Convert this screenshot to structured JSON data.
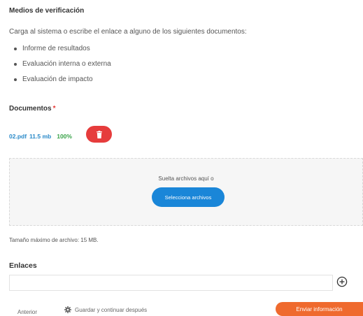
{
  "verification": {
    "title": "Medios de verificación",
    "intro": "Carga al sistema o escribe el enlace a alguno de los siguientes documentos:",
    "items": [
      {
        "label": "Informe de resultados"
      },
      {
        "label": "Evaluación interna o externa"
      },
      {
        "label": "Evaluación de impacto"
      }
    ]
  },
  "documents": {
    "label": "Documentos",
    "required_mark": "*",
    "file": {
      "name": "02.pdf",
      "size": "11.5 mb",
      "progress": "100%"
    },
    "delete_icon": "trash-icon"
  },
  "dropzone": {
    "text": "Suelta archivos aquí o",
    "button_label": "Selecciona archivos"
  },
  "max_size_text": "Tamaño máximo de archivo: 15 MB.",
  "links": {
    "title": "Enlaces",
    "input_value": "",
    "add_icon": "plus-circle-icon"
  },
  "footer": {
    "prev_label": "Anterior",
    "save_label": "Guardar y continuar después",
    "save_icon": "gear-icon",
    "send_label": "Enviar información"
  },
  "colors": {
    "delete": "#e63c3c",
    "primary_button": "#1a86d8",
    "send_button": "#ef6a2e",
    "file_link": "#2a8ac9",
    "progress": "#3aa34a",
    "required": "#e53935"
  }
}
